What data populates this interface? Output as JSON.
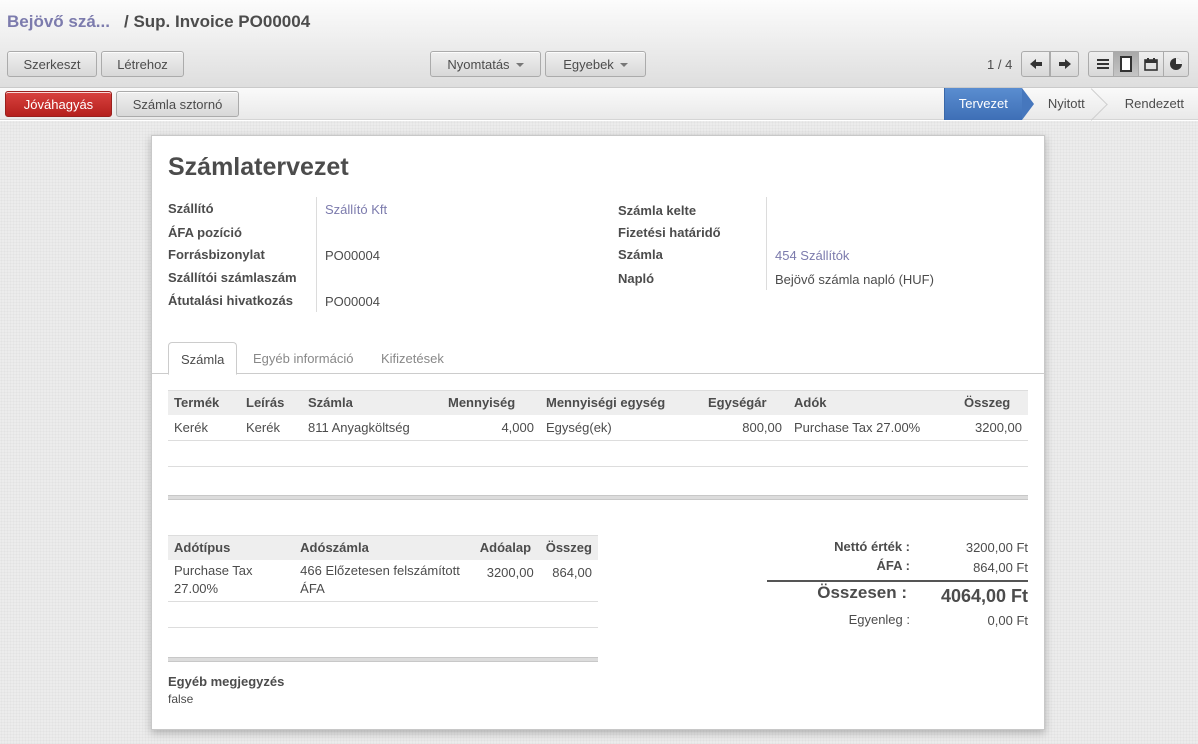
{
  "breadcrumb": {
    "parent": "Bejövő szá...",
    "separator": "/",
    "current": "Sup. Invoice PO00004"
  },
  "toolbar": {
    "edit": "Szerkeszt",
    "create": "Létrehoz",
    "print": "Nyomtatás",
    "more": "Egyebek"
  },
  "pager": {
    "text": "1 / 4"
  },
  "statusbar": {
    "approve": "Jóváhagyás",
    "cancel": "Számla sztornó",
    "steps": [
      "Tervezet",
      "Nyitott",
      "Rendezett"
    ],
    "active_step": "Tervezet"
  },
  "form": {
    "title": "Számlatervezet",
    "left": [
      {
        "label": "Szállító",
        "value": "Szállító Kft"
      },
      {
        "label": "ÁFA pozíció",
        "value": ""
      },
      {
        "label": "Forrásbizonylat",
        "value": "PO00004"
      },
      {
        "label": "Szállítói számlaszám",
        "value": ""
      },
      {
        "label": "Átutalási hivatkozás",
        "value": "PO00004"
      }
    ],
    "right": [
      {
        "label": "Számla kelte",
        "value": ""
      },
      {
        "label": "Fizetési határidő",
        "value": ""
      },
      {
        "label": "Számla",
        "value": "454 Szállítók"
      },
      {
        "label": "Napló",
        "value": "Bejövő számla napló (HUF)"
      }
    ]
  },
  "tabs": [
    "Számla",
    "Egyéb információ",
    "Kifizetések"
  ],
  "lines": {
    "headers": [
      "Termék",
      "Leírás",
      "Számla",
      "Mennyiség",
      "Mennyiségi egység",
      "Egységár",
      "Adók",
      "Összeg"
    ],
    "rows": [
      [
        "Kerék",
        "Kerék",
        "811 Anyagköltség",
        "4,000",
        "Egység(ek)",
        "800,00",
        "Purchase Tax 27.00%",
        "3200,00"
      ]
    ]
  },
  "taxes": {
    "headers": [
      "Adótípus",
      "Adószámla",
      "Adóalap",
      "Összeg"
    ],
    "rows": [
      [
        "Purchase Tax 27.00%",
        "466 Előzetesen felszámított ÁFA",
        "3200,00",
        "864,00"
      ]
    ]
  },
  "totals": {
    "net_label": "Nettó érték :",
    "net_value": "3200,00 Ft",
    "vat_label": "ÁFA :",
    "vat_value": "864,00 Ft",
    "total_label": "Összesen :",
    "total_value": "4064,00 Ft",
    "balance_label": "Egyenleg :",
    "balance_value": "0,00 Ft"
  },
  "notes": {
    "label": "Egyéb megjegyzés",
    "value": "false"
  }
}
